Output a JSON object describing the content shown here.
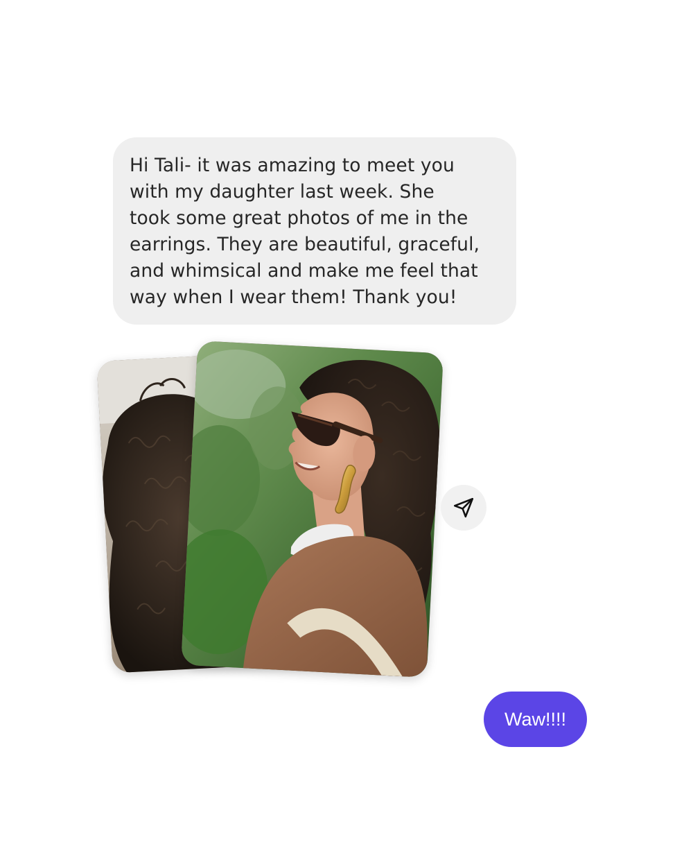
{
  "conversation": {
    "incoming_message": {
      "text": "Hi Tali- it was amazing to meet you\nwith my daughter last week. She\ntook some great photos of me in the\nearrings. They are beautiful, graceful,\nand whimsical and make me feel that\nway when I wear them! Thank you!"
    },
    "photos": [
      {
        "name": "photo-back",
        "subject": "back of head with curly dark hair"
      },
      {
        "name": "photo-front",
        "subject": "smiling woman in sunglasses wearing gold twisted earrings"
      }
    ],
    "share_icon": "share-icon",
    "outgoing_message": {
      "text": "Waw!!!!"
    }
  },
  "colors": {
    "incoming_bubble": "#efefef",
    "outgoing_bubble": "#5b45e6",
    "text_dark": "#262626",
    "share_button_bg": "#f1f1f1"
  }
}
